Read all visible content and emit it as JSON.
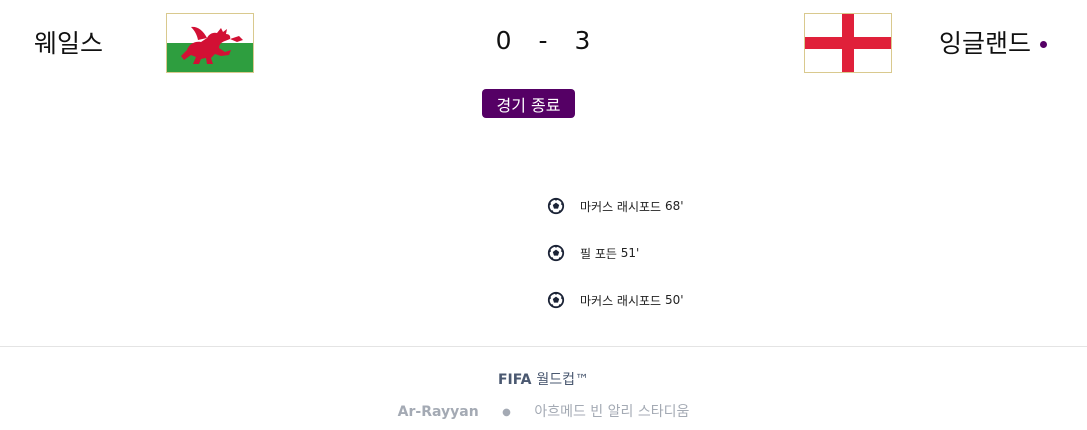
{
  "match": {
    "home_team": "웨일스",
    "away_team": "잉글랜드",
    "home_score": "0",
    "score_sep": "-",
    "away_score": "3",
    "status": "경기 종료"
  },
  "events": [
    {
      "player": "마커스 래시포드",
      "minute": "68'"
    },
    {
      "player": "필 포든",
      "minute": "51'"
    },
    {
      "player": "마커스 래시포드",
      "minute": "50'"
    }
  ],
  "footer": {
    "competition_prefix": "FIFA",
    "competition_name": "월드컵™",
    "city": "Ar-Rayyan",
    "separator": "●",
    "stadium": "아흐메드 빈 알리 스타디움"
  },
  "colors": {
    "accent": "#550065",
    "wales_green": "#2e9e3f",
    "wales_red": "#d21034",
    "england_red": "#e0203a"
  }
}
